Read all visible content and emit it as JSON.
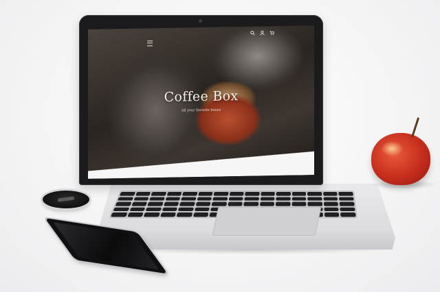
{
  "website": {
    "hero_title": "Coffee Box",
    "hero_subtitle": "All your favorite beans",
    "nav_icons": [
      "search-icon",
      "user-icon",
      "cart-icon"
    ]
  },
  "colors": {
    "hero_text": "#f6f2ec",
    "apple_red": "#c62d1c",
    "device_silver": "#dcdcdf"
  }
}
